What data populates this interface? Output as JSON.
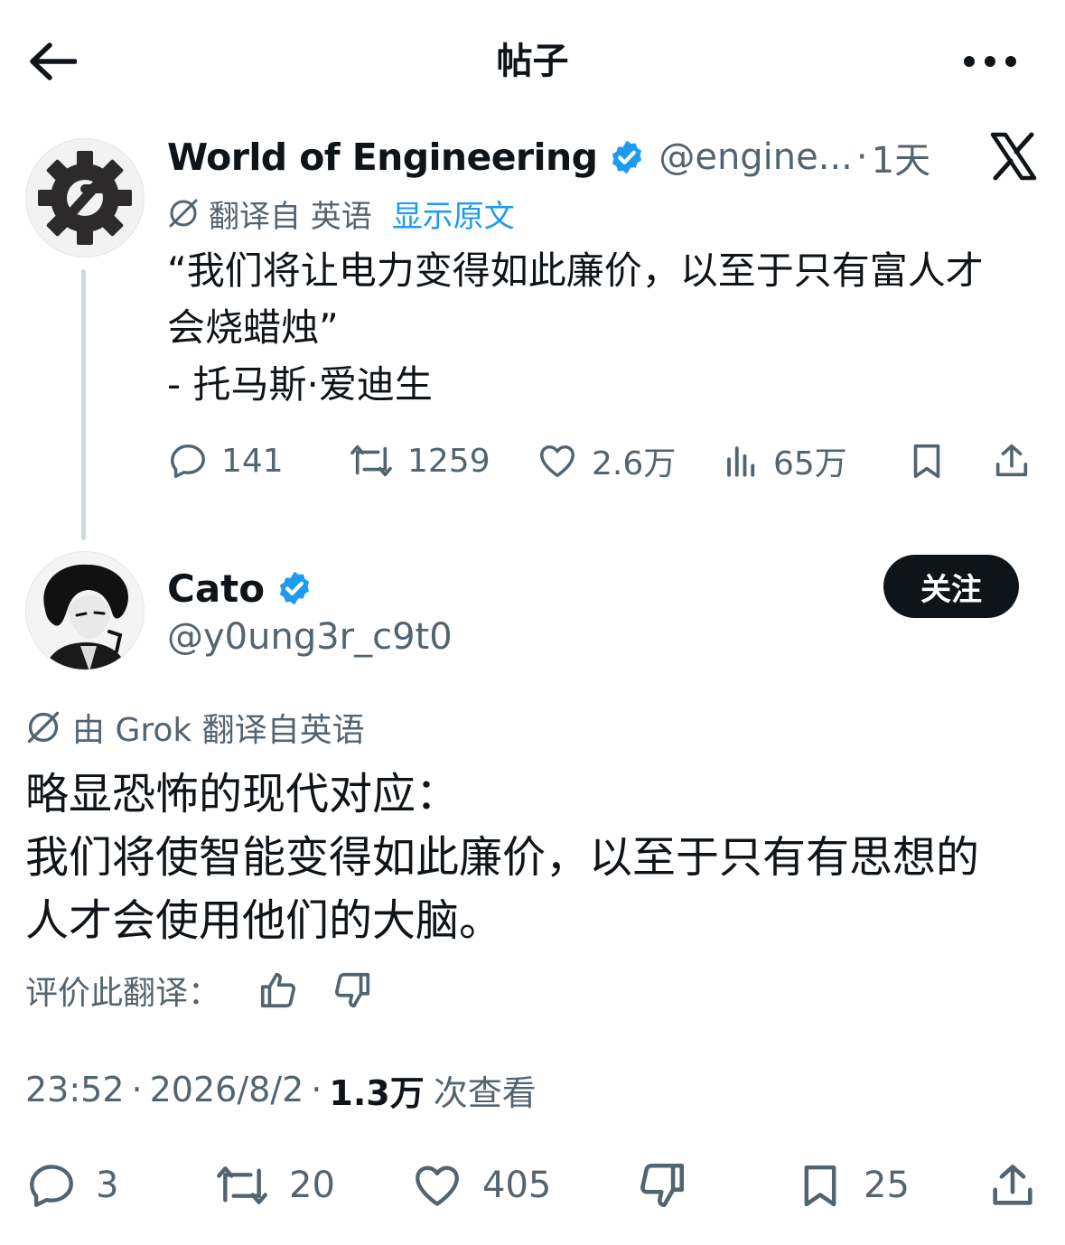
{
  "header": {
    "title": "帖子"
  },
  "quoted_post": {
    "author_name": "World of Engineering",
    "handle": "@engine...",
    "dot": "·",
    "time": "1天",
    "translated_from": "翻译自 英语",
    "show_original": "显示原文",
    "body": "“我们将让电力变得如此廉价，以至于只有富人才\n会烧蜡烛”\n- 托马斯·爱迪生",
    "stats": {
      "replies": "141",
      "reposts": "1259",
      "likes": "2.6万",
      "views": "65万"
    }
  },
  "main_post": {
    "author_name": "Cato",
    "handle": "@y0ung3r_c9t0",
    "follow_label": "关注",
    "translated_by": "由 Grok 翻译自英语",
    "body": "略显恐怖的现代对应：\n我们将使智能变得如此廉价，以至于只有有思想的\n人才会使用他们的大脑。",
    "rate_label": "评价此翻译：",
    "time": "23:52",
    "date": "2026/8/2",
    "views": "1.3万",
    "views_label": "次查看",
    "separator": "·",
    "stats": {
      "replies": "3",
      "reposts": "20",
      "likes": "405",
      "bookmarks": "25"
    }
  },
  "colors": {
    "text": "#0f1419",
    "secondary": "#536471",
    "link": "#1d9bf0",
    "verified": "#1d9bf0",
    "follow_bg": "#0f1419"
  }
}
